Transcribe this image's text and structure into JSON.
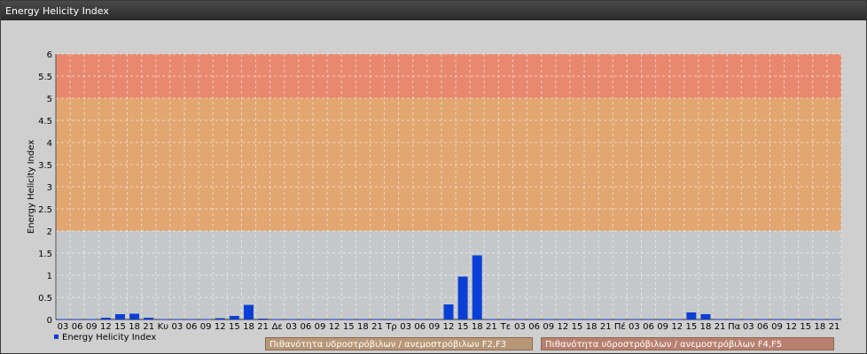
{
  "window": {
    "title": "Energy Helicity Index"
  },
  "colors": {
    "low_band": "#c5c8cb",
    "mid_band": "#e2a671",
    "high_band": "#e8896f",
    "bar": "#0a3fd6"
  },
  "band_labels": [
    {
      "text": "Πιθανότητα υδροστρόβιλων / ανεμοστρόβιλων F2,F3",
      "color": "#b89777"
    },
    {
      "text": "Πιθανότητα υδροστρόβιλων / ανεμοστρόβιλων F4,F5",
      "color": "#b9806f"
    }
  ],
  "chart_data": {
    "type": "bar",
    "ylabel": "Energy Helicity Index",
    "ylim": [
      0,
      6
    ],
    "yticks": [
      0,
      0.5,
      1,
      1.5,
      2,
      2.5,
      3,
      3.5,
      4,
      4.5,
      5,
      5.5,
      6
    ],
    "bands": [
      {
        "from": 0,
        "to": 2,
        "level": "low"
      },
      {
        "from": 2,
        "to": 5,
        "level": "mid"
      },
      {
        "from": 5,
        "to": 6,
        "level": "high"
      }
    ],
    "categories": [
      "03",
      "06",
      "09",
      "12",
      "15",
      "18",
      "21",
      "Κυ",
      "03",
      "06",
      "09",
      "12",
      "15",
      "18",
      "21",
      "Δε",
      "03",
      "06",
      "09",
      "12",
      "15",
      "18",
      "21",
      "Τρ",
      "03",
      "06",
      "09",
      "12",
      "15",
      "18",
      "21",
      "Τε",
      "03",
      "06",
      "09",
      "12",
      "15",
      "18",
      "21",
      "Πέ",
      "03",
      "06",
      "09",
      "12",
      "15",
      "18",
      "21",
      "Πα",
      "03",
      "06",
      "09",
      "12",
      "15",
      "18",
      "21"
    ],
    "series": [
      {
        "name": "Energy Helicity Index",
        "values": [
          0.01,
          0.01,
          0.01,
          0.04,
          0.12,
          0.13,
          0.04,
          0.01,
          0.01,
          0.01,
          0.01,
          0.03,
          0.08,
          0.33,
          0.02,
          0.01,
          0.01,
          0.01,
          0.01,
          0.01,
          0.01,
          0.01,
          0.01,
          0.01,
          0.01,
          0.01,
          0.01,
          0.34,
          0.97,
          1.45,
          0.01,
          0.01,
          0.01,
          0.01,
          0.01,
          0.01,
          0.01,
          0.01,
          0.01,
          0.01,
          0.01,
          0.01,
          0.01,
          0.01,
          0.16,
          0.12,
          0.01,
          0.01,
          0.01,
          0.01,
          0.01,
          0.01,
          0.01,
          0.01,
          0.01
        ]
      }
    ],
    "legend": "bottom-left"
  }
}
